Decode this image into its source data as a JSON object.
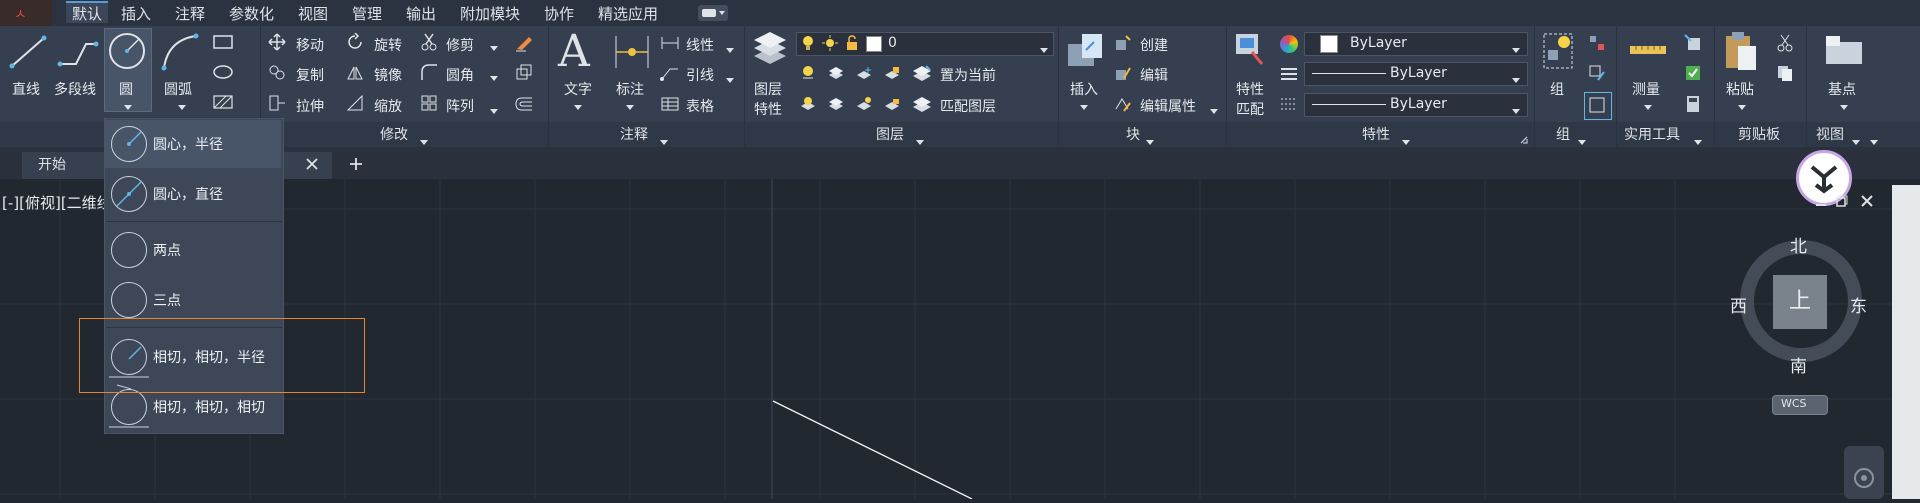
{
  "menu": {
    "items": [
      "默认",
      "插入",
      "注释",
      "参数化",
      "视图",
      "管理",
      "输出",
      "附加模块",
      "协作",
      "精选应用"
    ],
    "active": "默认"
  },
  "draw": {
    "line": "直线",
    "polyline": "多段线",
    "circle": "圆",
    "arc": "圆弧"
  },
  "modify": {
    "move": "移动",
    "rotate": "旋转",
    "trim": "修剪",
    "copy": "复制",
    "mirror": "镜像",
    "fillet": "圆角",
    "stretch": "拉伸",
    "scale": "缩放",
    "array": "阵列",
    "title": "修改"
  },
  "annotation": {
    "text": "文字",
    "dimension": "标注",
    "linear": "线性",
    "leader": "引线",
    "table": "表格",
    "title": "注释"
  },
  "layers": {
    "properties": "图层\n特性",
    "properties_line1": "图层",
    "properties_line2": "特性",
    "current_layer": "0",
    "set_current": "置为当前",
    "match_layer": "匹配图层",
    "title": "图层"
  },
  "block": {
    "insert": "插入",
    "create": "创建",
    "edit": "编辑",
    "edit_attr": "编辑属性",
    "title": "块"
  },
  "properties": {
    "match_line1": "特性",
    "match_line2": "匹配",
    "color": "ByLayer",
    "linetype": "ByLayer",
    "lineweight": "ByLayer",
    "title": "特性"
  },
  "groups": {
    "group": "组",
    "title": "组"
  },
  "utilities": {
    "measure": "测量",
    "title": "实用工具"
  },
  "clipboard": {
    "paste": "粘贴",
    "title": "剪贴板"
  },
  "view": {
    "base": "基点",
    "title": "视图"
  },
  "tabs": {
    "start": "开始"
  },
  "viewport": {
    "label": "[-][俯视][二维线"
  },
  "circle_menu": {
    "items": [
      "圆心，半径",
      "圆心，直径",
      "两点",
      "三点",
      "相切，相切，半径",
      "相切，相切，相切"
    ]
  },
  "compass": {
    "north": "北",
    "south": "南",
    "east": "东",
    "west": "西",
    "top": "上",
    "wcs": "WCS"
  },
  "colors": {
    "accent": "#5a9bd6",
    "highlight": "#e8852f",
    "ribbon": "#353f4f",
    "canvas": "#212830"
  }
}
